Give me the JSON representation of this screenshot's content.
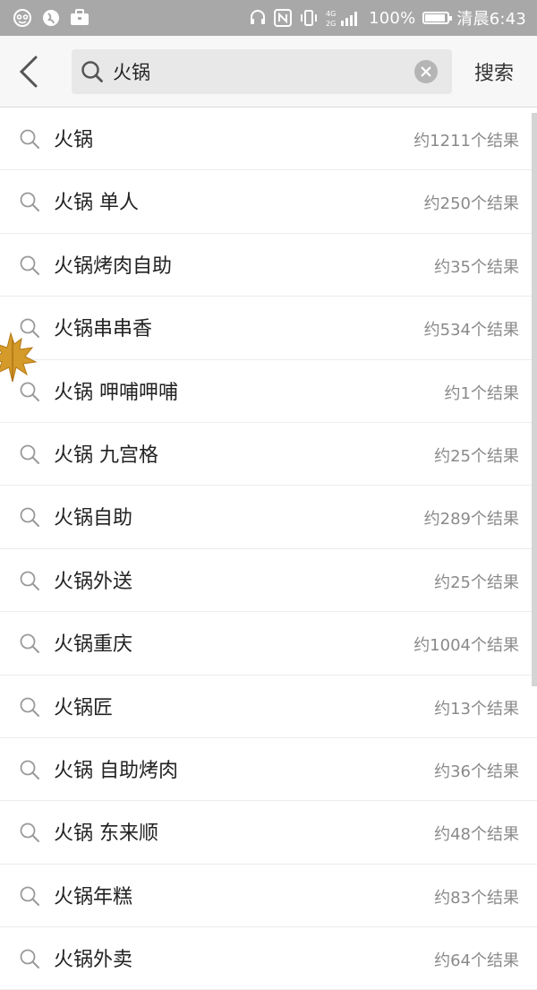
{
  "status_bar": {
    "battery": "100%",
    "time": "清晨6:43",
    "network": "4G",
    "network2": "2G",
    "battery_level": 1.0
  },
  "search": {
    "query": "火锅",
    "submit_label": "搜索"
  },
  "results": [
    {
      "term": "火锅",
      "count": "约1211个结果"
    },
    {
      "term": "火锅 单人",
      "count": "约250个结果"
    },
    {
      "term": "火锅烤肉自助",
      "count": "约35个结果"
    },
    {
      "term": "火锅串串香",
      "count": "约534个结果"
    },
    {
      "term": "火锅 呷哺呷哺",
      "count": "约1个结果"
    },
    {
      "term": "火锅 九宫格",
      "count": "约25个结果"
    },
    {
      "term": "火锅自助",
      "count": "约289个结果"
    },
    {
      "term": "火锅外送",
      "count": "约25个结果"
    },
    {
      "term": "火锅重庆",
      "count": "约1004个结果"
    },
    {
      "term": "火锅匠",
      "count": "约13个结果"
    },
    {
      "term": "火锅 自助烤肉",
      "count": "约36个结果"
    },
    {
      "term": "火锅 东来顺",
      "count": "约48个结果"
    },
    {
      "term": "火锅年糕",
      "count": "约83个结果"
    },
    {
      "term": "火锅外卖",
      "count": "约64个结果"
    }
  ],
  "colors": {
    "status_bar": "#a8a8a8",
    "header_bg": "#f7f7f7",
    "search_box_bg": "#e8e8e8",
    "count_text": "#8a8a8a",
    "leaf": "#d49a2a"
  }
}
